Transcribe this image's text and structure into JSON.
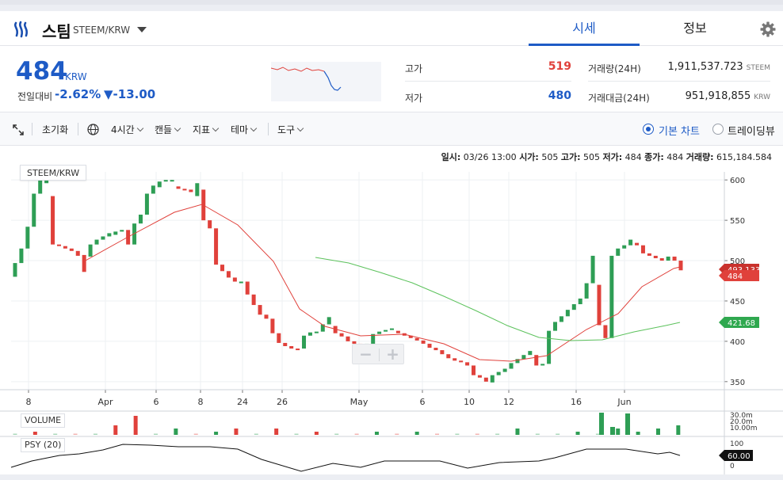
{
  "header": {
    "coin_name": "스팀",
    "coin_pair": "STEEM/KRW",
    "tabs": [
      {
        "label": "시세",
        "active": true
      },
      {
        "label": "정보",
        "active": false
      }
    ],
    "logo_icon": "steem-logo-icon",
    "settings_icon": "gear-icon"
  },
  "summary": {
    "price": "484",
    "unit": "KRW",
    "change_label": "전일대비",
    "change_pct": "-2.62%",
    "change_abs": "▼-13.00",
    "high_label": "고가",
    "high_value": "519",
    "low_label": "저가",
    "low_value": "480",
    "volume_label": "거래량(24H)",
    "volume_value": "1,911,537.723",
    "volume_unit": "STEEM",
    "amount_label": "거래대금(24H)",
    "amount_value": "951,918,855",
    "amount_unit": "KRW"
  },
  "toolbar": {
    "reset": "초기화",
    "interval": "4시간",
    "candle": "캔들",
    "indicator": "지표",
    "theme": "테마",
    "tools": "도구",
    "basic_chart": "기본 차트",
    "tradingview": "트레이딩뷰",
    "basic_selected": true
  },
  "ohlc_info": {
    "date_label": "일시:",
    "date_value": "03/26 13:00",
    "open_label": "시가:",
    "open_value": "505",
    "high_label": "고가:",
    "high_value": "505",
    "low_label": "저가:",
    "low_value": "484",
    "close_label": "종가:",
    "close_value": "484",
    "volume_label": "거래량:",
    "volume_value": "615,184.584"
  },
  "colors": {
    "up": "#2e9e55",
    "down": "#e0413b",
    "accent": "#1e5bc6",
    "ma_short": "#e0413b",
    "ma_long": "#5cc25c"
  },
  "chart_data": {
    "type": "candlestick",
    "legend": "STEEM/KRW",
    "y_ticks": [
      "600",
      "550",
      "500",
      "450",
      "400",
      "350"
    ],
    "y_range": [
      340,
      610
    ],
    "x_tick_labels": [
      "8",
      "Apr",
      "6",
      "8",
      "24",
      "26",
      "May",
      "6",
      "10",
      "12",
      "16",
      "Jun"
    ],
    "price_tags": {
      "ma": "493.133",
      "last": "484",
      "ma_long": "421.68"
    },
    "candles": [
      [
        480,
        497
      ],
      [
        497,
        515
      ],
      [
        515,
        542
      ],
      [
        542,
        583
      ],
      [
        583,
        600
      ],
      [
        596,
        607
      ],
      [
        580,
        520
      ],
      [
        520,
        518
      ],
      [
        518,
        515
      ],
      [
        515,
        512
      ],
      [
        512,
        506
      ],
      [
        507,
        486
      ],
      [
        505,
        520
      ],
      [
        520,
        526
      ],
      [
        526,
        530
      ],
      [
        530,
        534
      ],
      [
        532,
        536
      ],
      [
        536,
        538
      ],
      [
        538,
        520
      ],
      [
        520,
        546
      ],
      [
        546,
        557
      ],
      [
        557,
        583
      ],
      [
        583,
        593
      ],
      [
        591,
        598
      ],
      [
        598,
        600
      ],
      [
        600,
        600
      ],
      [
        592,
        589
      ],
      [
        589,
        588
      ],
      [
        588,
        585
      ],
      [
        580,
        596
      ],
      [
        588,
        550
      ],
      [
        550,
        540
      ],
      [
        540,
        495
      ],
      [
        495,
        487
      ],
      [
        487,
        479
      ],
      [
        479,
        474
      ],
      [
        474,
        474
      ],
      [
        474,
        458
      ],
      [
        458,
        445
      ],
      [
        445,
        433
      ],
      [
        433,
        428
      ],
      [
        428,
        410
      ],
      [
        410,
        398
      ],
      [
        398,
        394
      ],
      [
        394,
        391
      ],
      [
        391,
        389
      ],
      [
        391,
        407
      ],
      [
        407,
        411
      ],
      [
        411,
        412
      ],
      [
        412,
        421
      ],
      [
        421,
        430
      ],
      [
        419,
        410
      ],
      [
        410,
        406
      ],
      [
        406,
        400
      ],
      [
        400,
        397
      ],
      [
        397,
        393
      ],
      [
        393,
        397
      ],
      [
        397,
        409
      ],
      [
        409,
        412
      ],
      [
        412,
        414
      ],
      [
        414,
        416
      ],
      [
        413,
        410
      ],
      [
        410,
        407
      ],
      [
        407,
        404
      ],
      [
        404,
        401
      ],
      [
        401,
        397
      ],
      [
        397,
        392
      ],
      [
        392,
        389
      ],
      [
        389,
        384
      ],
      [
        384,
        379
      ],
      [
        379,
        376
      ],
      [
        376,
        374
      ],
      [
        374,
        370
      ],
      [
        370,
        358
      ],
      [
        358,
        355
      ],
      [
        355,
        350
      ],
      [
        349,
        358
      ],
      [
        358,
        362
      ],
      [
        362,
        366
      ],
      [
        366,
        373
      ],
      [
        373,
        378
      ],
      [
        378,
        383
      ],
      [
        383,
        388
      ],
      [
        383,
        370
      ],
      [
        370,
        372
      ],
      [
        372,
        413
      ],
      [
        413,
        424
      ],
      [
        424,
        431
      ],
      [
        431,
        439
      ],
      [
        439,
        446
      ],
      [
        446,
        453
      ],
      [
        453,
        472
      ],
      [
        472,
        506
      ],
      [
        470,
        420
      ],
      [
        420,
        404
      ],
      [
        404,
        506
      ],
      [
        506,
        515
      ],
      [
        515,
        519
      ],
      [
        519,
        526
      ],
      [
        522,
        519
      ],
      [
        519,
        509
      ],
      [
        509,
        506
      ],
      [
        506,
        503
      ],
      [
        503,
        500
      ],
      [
        500,
        505
      ],
      [
        505,
        500
      ],
      [
        500,
        488
      ]
    ],
    "ma_short": [
      [
        106,
        316
      ],
      [
        160,
        286
      ],
      [
        220,
        254
      ],
      [
        255,
        244
      ],
      [
        300,
        270
      ],
      [
        345,
        316
      ],
      [
        378,
        376
      ],
      [
        410,
        398
      ],
      [
        455,
        410
      ],
      [
        510,
        408
      ],
      [
        560,
        420
      ],
      [
        605,
        440
      ],
      [
        645,
        442
      ],
      [
        690,
        435
      ],
      [
        740,
        402
      ],
      [
        780,
        382
      ],
      [
        810,
        348
      ],
      [
        850,
        325
      ],
      [
        858,
        323
      ]
    ],
    "ma_long": [
      [
        398,
        311
      ],
      [
        440,
        318
      ],
      [
        480,
        330
      ],
      [
        520,
        343
      ],
      [
        560,
        360
      ],
      [
        600,
        378
      ],
      [
        640,
        397
      ],
      [
        680,
        412
      ],
      [
        720,
        416
      ],
      [
        760,
        415
      ],
      [
        800,
        405
      ],
      [
        840,
        397
      ],
      [
        858,
        393
      ]
    ],
    "volume": [
      [
        0,
        0
      ],
      [
        1,
        1
      ],
      [
        0,
        0
      ],
      [
        1,
        0
      ],
      [
        0,
        0
      ],
      [
        1,
        3
      ],
      [
        1,
        6
      ],
      [
        0,
        0
      ],
      [
        0,
        2
      ],
      [
        1,
        0
      ],
      [
        0,
        1
      ],
      [
        1,
        2
      ],
      [
        0,
        0
      ],
      [
        1,
        2
      ],
      [
        0,
        0
      ],
      [
        1,
        1
      ],
      [
        0,
        0
      ],
      [
        1,
        0
      ],
      [
        0,
        1
      ],
      [
        1,
        0
      ],
      [
        0,
        1
      ],
      [
        1,
        0
      ],
      [
        0,
        0
      ],
      [
        1,
        0
      ],
      [
        0,
        0
      ],
      [
        0,
        2
      ],
      [
        0,
        0
      ],
      [
        0,
        0
      ],
      [
        0,
        1
      ],
      [
        0,
        0
      ],
      [
        0,
        2
      ],
      [
        0,
        1
      ],
      [
        0,
        2
      ],
      [
        0,
        3
      ]
    ],
    "volume_ticks": [
      "30.0m",
      "20.0m",
      "10.00m"
    ],
    "psy_label": "PSY (20)",
    "psy_ticks": [
      "100",
      "0"
    ],
    "psy_value": "60.00",
    "psy_points": [
      [
        14,
        576
      ],
      [
        40,
        568
      ],
      [
        75,
        561
      ],
      [
        100,
        559
      ],
      [
        130,
        554
      ],
      [
        155,
        547
      ],
      [
        190,
        548
      ],
      [
        225,
        550
      ],
      [
        265,
        550
      ],
      [
        300,
        553
      ],
      [
        330,
        566
      ],
      [
        380,
        581
      ],
      [
        420,
        571
      ],
      [
        455,
        576
      ],
      [
        485,
        568
      ],
      [
        520,
        568
      ],
      [
        555,
        568
      ],
      [
        590,
        577
      ],
      [
        630,
        570
      ],
      [
        680,
        568
      ],
      [
        700,
        564
      ],
      [
        740,
        553
      ],
      [
        790,
        553
      ],
      [
        830,
        559
      ],
      [
        845,
        557
      ],
      [
        858,
        561
      ]
    ]
  }
}
